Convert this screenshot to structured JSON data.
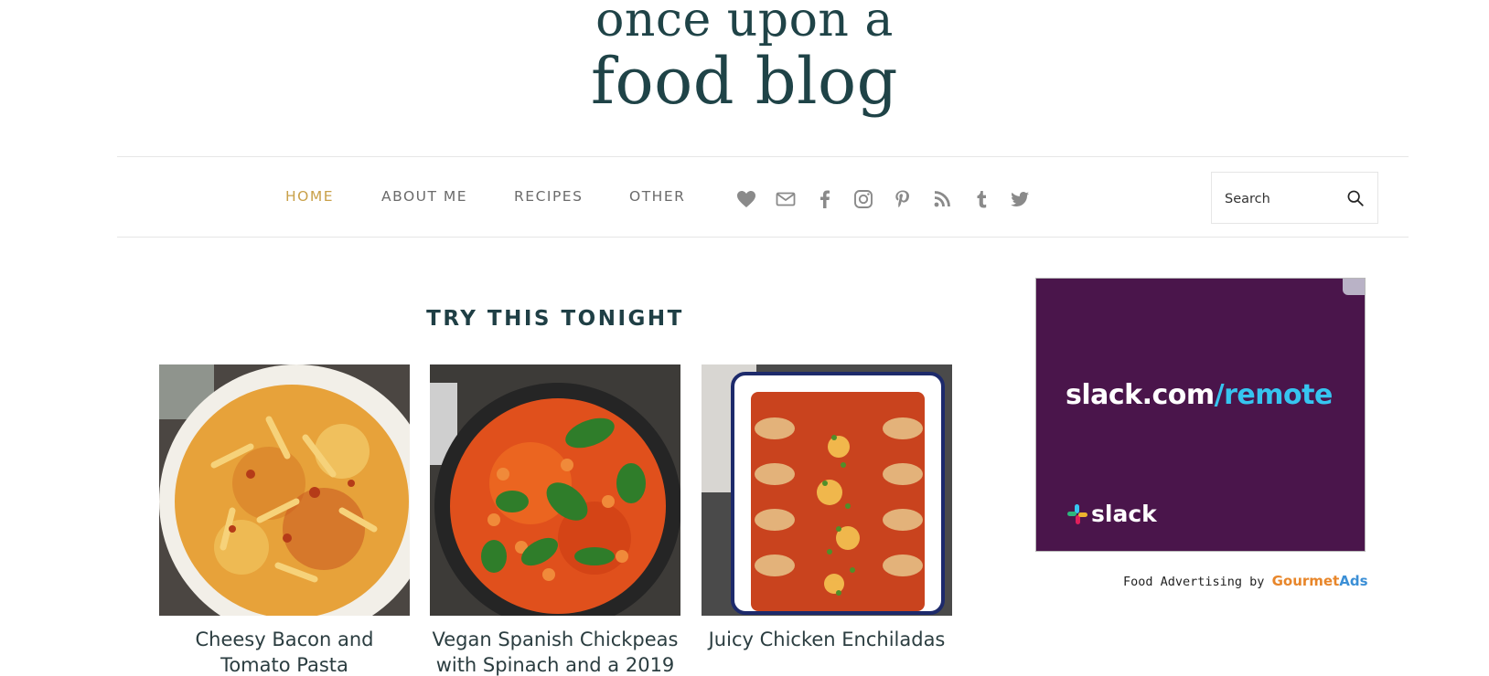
{
  "logo": {
    "line1": "once upon a",
    "line2": "food blog"
  },
  "nav": {
    "items": [
      {
        "label": "HOME",
        "active": true
      },
      {
        "label": "ABOUT ME",
        "active": false
      },
      {
        "label": "RECIPES",
        "active": false
      },
      {
        "label": "OTHER",
        "active": false
      }
    ],
    "social_icons": [
      "heart-icon",
      "email-icon",
      "facebook-icon",
      "instagram-icon",
      "pinterest-icon",
      "rss-icon",
      "tumblr-icon",
      "twitter-icon"
    ],
    "search": {
      "placeholder": "Search",
      "icon": "search-icon"
    },
    "active_color": "#c9a14a",
    "text_color": "#6b6b6b"
  },
  "main": {
    "section_title": "TRY THIS TONIGHT",
    "recipes": [
      {
        "title": "Cheesy Bacon and Tomato Pasta"
      },
      {
        "title": "Vegan Spanish Chickpeas with Spinach and a 2019"
      },
      {
        "title": "Juicy Chicken Enchiladas"
      }
    ]
  },
  "ad": {
    "url_main": "slack.com",
    "url_accent": "/remote",
    "brand": "slack",
    "background": "#4a154b",
    "accent": "#36c5f0",
    "credit_prefix": "Food Advertising by",
    "credit_brand_1": "Gourmet",
    "credit_brand_2": "Ads"
  }
}
